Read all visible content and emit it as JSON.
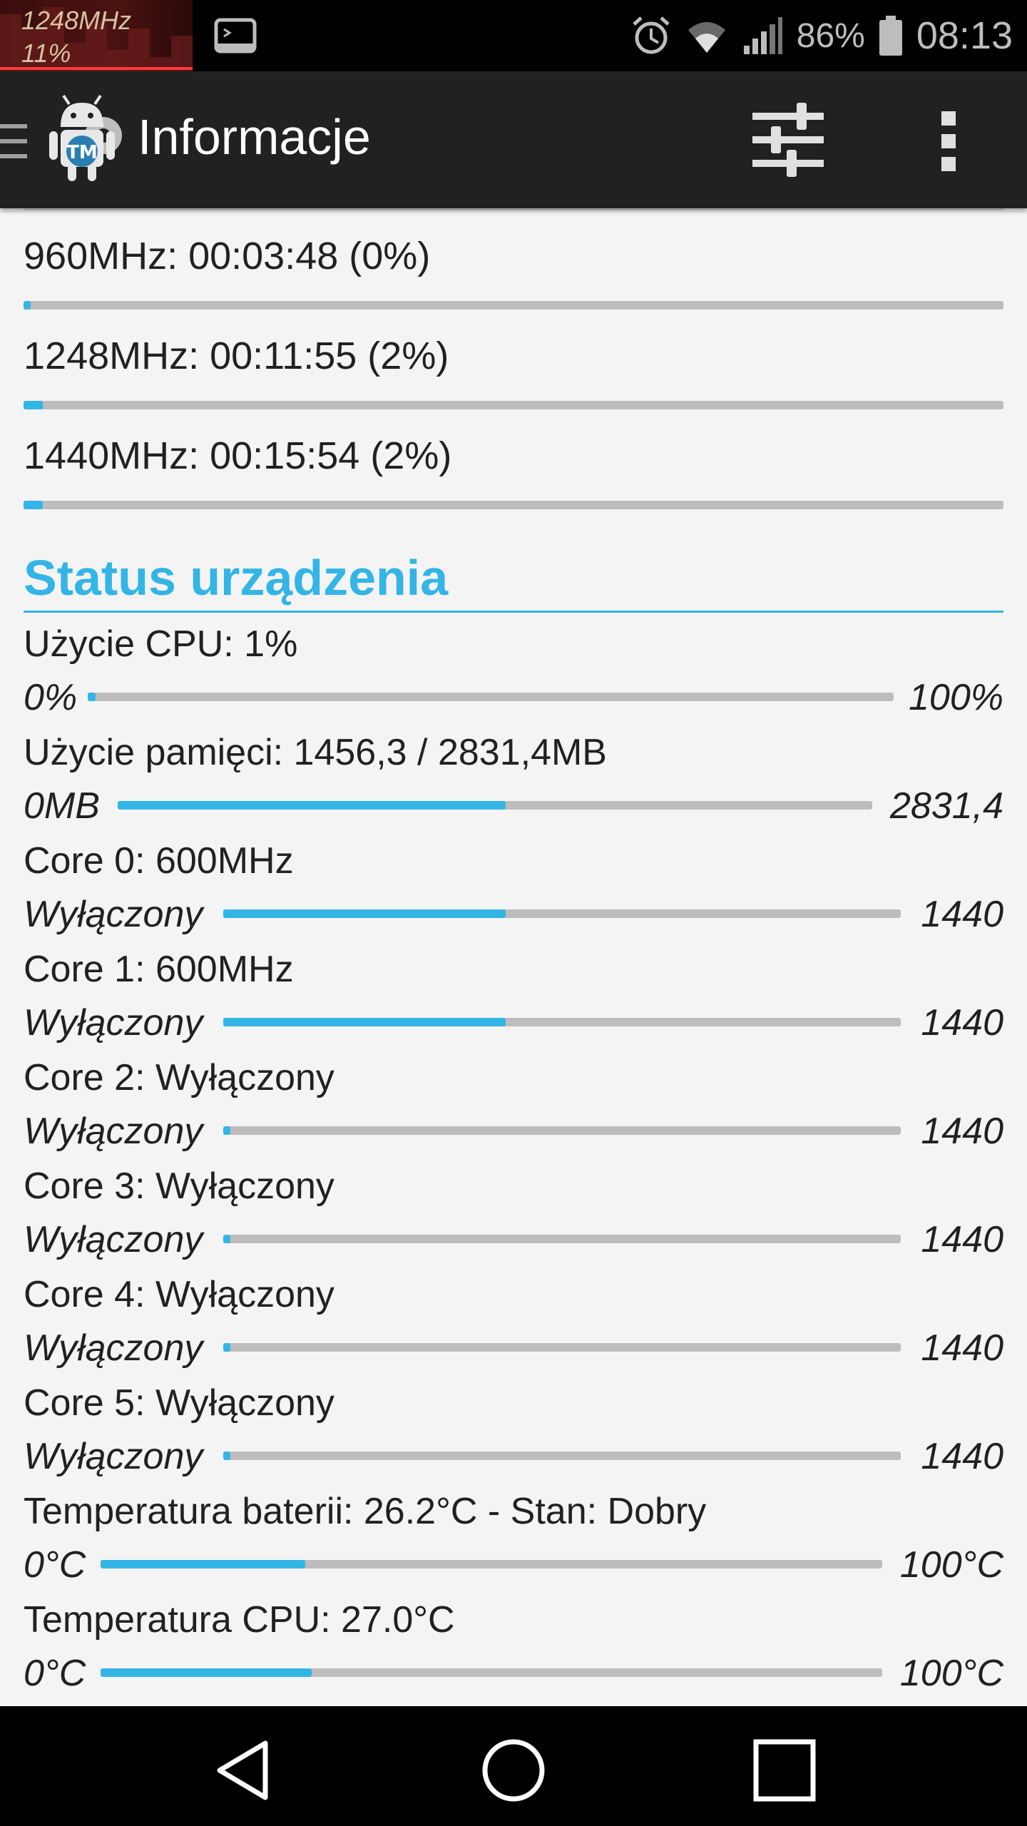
{
  "status_bar": {
    "cpu_freq": "1248MHz",
    "cpu_load": "11%",
    "battery_percent": "86%",
    "time": "08:13",
    "icons": [
      "terminal-icon",
      "alarm-icon",
      "wifi-icon",
      "signal-icon",
      "battery-icon"
    ]
  },
  "toolbar": {
    "title": "Informacje",
    "icons": [
      "menu-icon",
      "app-logo-icon",
      "filters-icon",
      "overflow-icon"
    ]
  },
  "frequency_stats": [
    {
      "label": "960MHz: 00:03:48 (0%)",
      "fraction": 0.0
    },
    {
      "label": "1248MHz: 00:11:55 (2%)",
      "fraction": 0.02
    },
    {
      "label": "1440MHz: 00:15:54 (2%)",
      "fraction": 0.02
    }
  ],
  "device_status": {
    "header": "Status urządzenia",
    "rows": [
      {
        "label": "Użycie CPU: 1%",
        "min": "0%",
        "max": "100%",
        "fraction": 0.01
      },
      {
        "label": "Użycie pamięci: 1456,3 / 2831,4MB",
        "min": "0MB",
        "max": "2831,4",
        "fraction": 0.514
      },
      {
        "label": "Core 0: 600MHz",
        "min": "Wyłączony",
        "max": "1440",
        "fraction": 0.417
      },
      {
        "label": "Core 1: 600MHz",
        "min": "Wyłączony",
        "max": "1440",
        "fraction": 0.417
      },
      {
        "label": "Core 2: Wyłączony",
        "min": "Wyłączony",
        "max": "1440",
        "fraction": 0.0
      },
      {
        "label": "Core 3: Wyłączony",
        "min": "Wyłączony",
        "max": "1440",
        "fraction": 0.0
      },
      {
        "label": "Core 4: Wyłączony",
        "min": "Wyłączony",
        "max": "1440",
        "fraction": 0.0
      },
      {
        "label": "Core 5: Wyłączony",
        "min": "Wyłączony",
        "max": "1440",
        "fraction": 0.0
      },
      {
        "label": "Temperatura baterii: 26.2°C - Stan: Dobry",
        "min": "0°C",
        "max": "100°C",
        "fraction": 0.262
      },
      {
        "label": "Temperatura CPU: 27.0°C",
        "min": "0°C",
        "max": "100°C",
        "fraction": 0.27
      }
    ]
  },
  "nav_bar": {
    "icons": [
      "back-icon",
      "home-icon",
      "recents-icon"
    ]
  },
  "colors": {
    "accent": "#33b5e5",
    "toolbar": "#212121",
    "background": "#f4f4f4",
    "track": "#bdbdbd"
  }
}
